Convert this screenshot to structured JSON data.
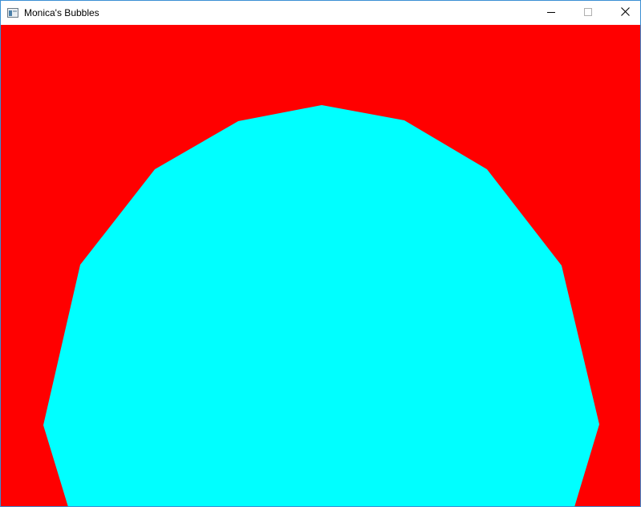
{
  "window": {
    "title": "Monica's Bubbles",
    "icon": "app-window-icon",
    "controls": {
      "minimize_icon": "minimize-icon",
      "maximize_icon": "maximize-icon",
      "close_icon": "close-icon"
    }
  },
  "scene": {
    "background_color": "#ff0000",
    "bubble_color": "#00ffff",
    "bubble_shape": "polygon"
  }
}
